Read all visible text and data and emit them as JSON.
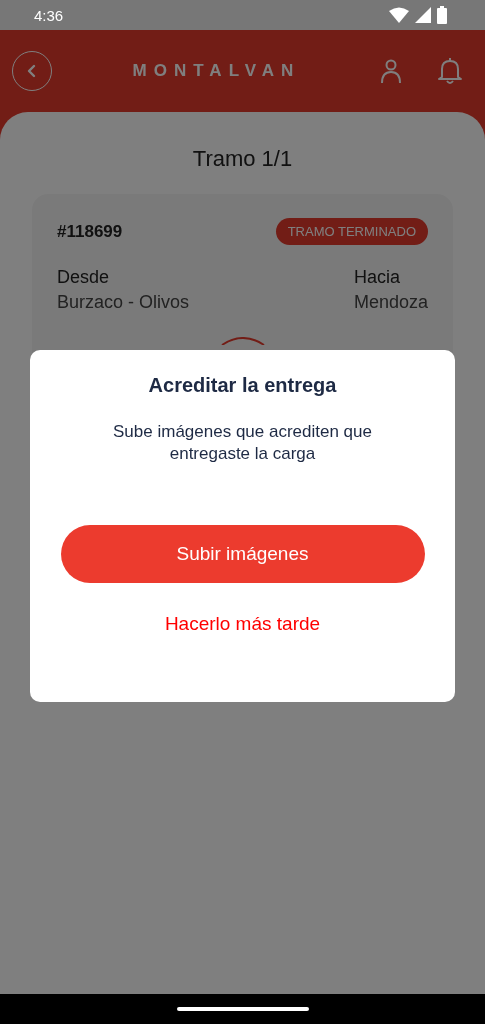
{
  "status_bar": {
    "time": "4:36"
  },
  "header": {
    "title": "MONTALVAN"
  },
  "page": {
    "title": "Tramo 1/1"
  },
  "trip": {
    "number": "#118699",
    "status": "TRAMO TERMINADO",
    "from_label": "Desde",
    "from": "Burzaco - Olivos",
    "to_label": "Hacia",
    "to": "Mendoza"
  },
  "dialog": {
    "title": "Acreditar la entrega",
    "message": "Sube  imágenes que acrediten que entregaste la carga",
    "primary_button": "Subir imágenes",
    "secondary_button": "Hacerlo más tarde"
  }
}
